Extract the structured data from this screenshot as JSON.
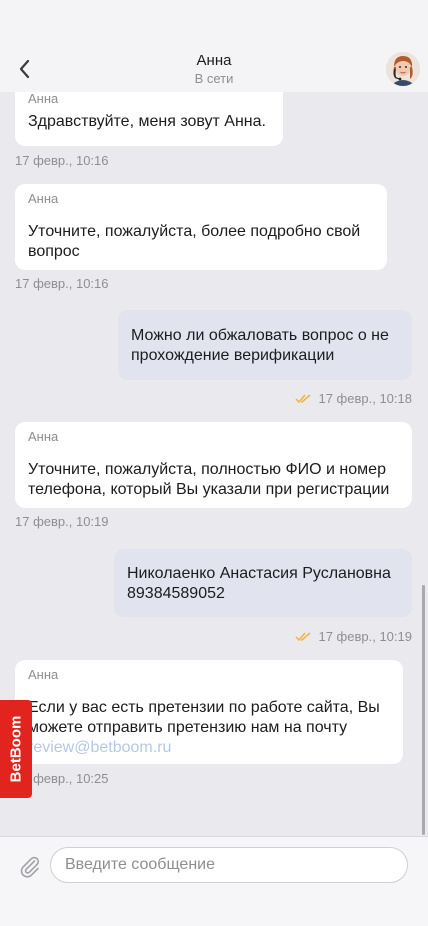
{
  "header": {
    "name": "Анна",
    "status": "В сети"
  },
  "messages": [
    {
      "sender": "Анна",
      "lines": [
        "Здравствуйте, меня зовут Анна."
      ],
      "time": "17 февр., 10:16"
    },
    {
      "sender": "Анна",
      "lines": [
        "Уточните, пожалуйста, более подробно свой",
        "вопрос"
      ],
      "time": "17 февр., 10:16"
    },
    {
      "lines": [
        "Можно ли обжаловать вопрос о не",
        "прохождение верификации"
      ],
      "time": "17 февр., 10:18"
    },
    {
      "sender": "Анна",
      "lines": [
        "Уточните, пожалуйста, полностью ФИО и номер",
        "телефона, который Вы указали при регистрации"
      ],
      "time": "17 февр., 10:19"
    },
    {
      "lines": [
        "Николаенко Анастасия Руслановна",
        "89384589052"
      ],
      "time": "17 февр., 10:19"
    },
    {
      "sender": "Анна",
      "lines": [
        "Если у вас есть претензии по работе сайта, Вы",
        "можете отправить претензию нам на почту"
      ],
      "link": "review@betboom.ru",
      "time": "17 февр., 10:25"
    }
  ],
  "badge": {
    "label": "BetBoom"
  },
  "composer": {
    "placeholder": "Введите сообщение"
  },
  "colors": {
    "outgoing_bubble": "#e1e3ef",
    "incoming_bubble": "#ffffff",
    "read_checks": "#f0b43c",
    "brand_red": "#e1241d"
  },
  "icons": {
    "back": "chevron-left",
    "attach": "paperclip",
    "read": "double-check"
  }
}
